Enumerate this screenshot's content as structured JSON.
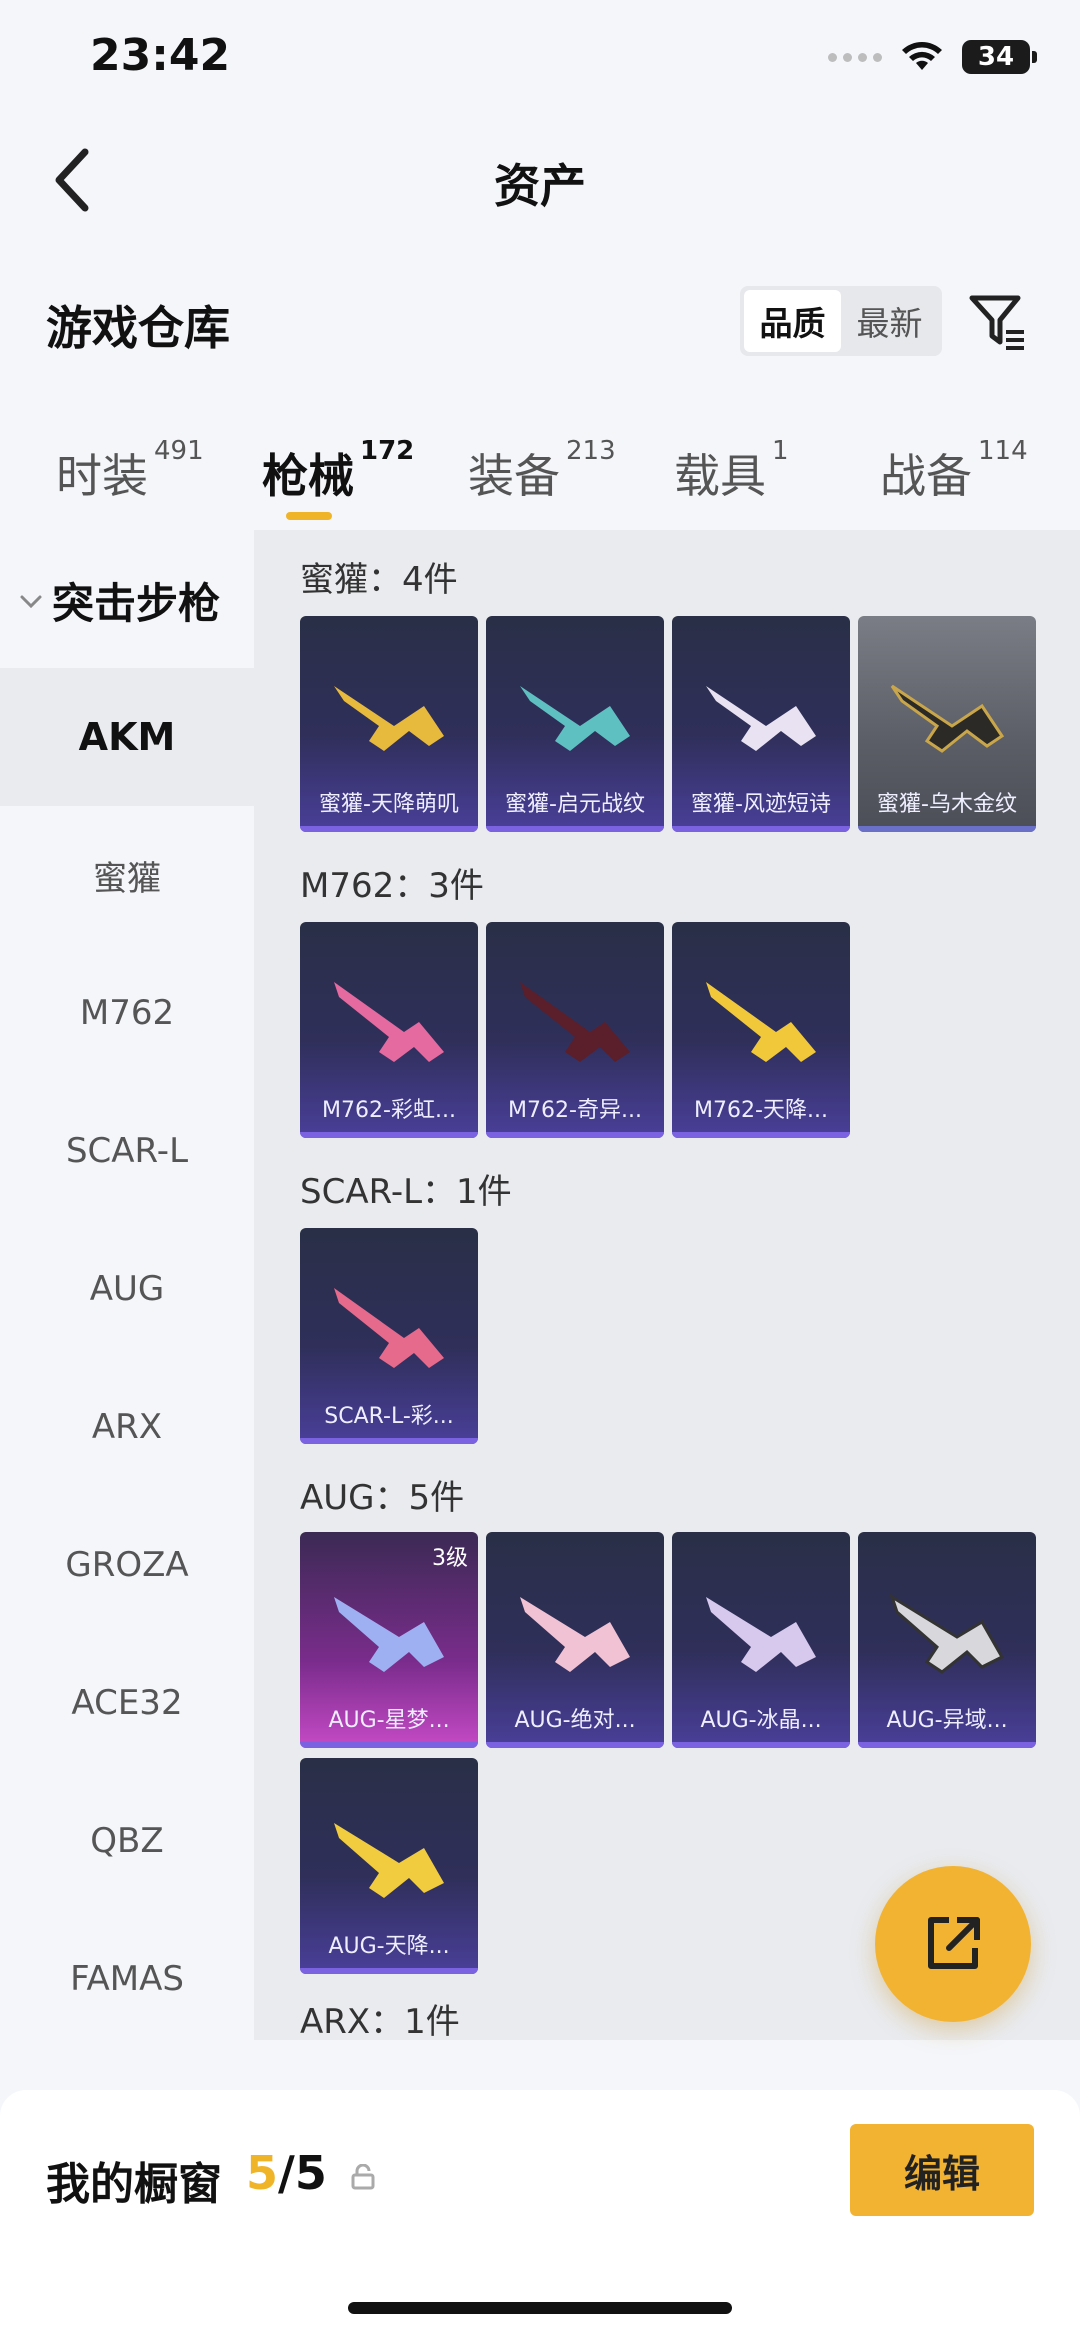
{
  "status_bar": {
    "time": "23:42",
    "battery": "34"
  },
  "header": {
    "title": "资产"
  },
  "section": {
    "title": "游戏仓库",
    "sort_options": [
      "品质",
      "最新"
    ],
    "active_sort": "品质"
  },
  "tabs": [
    {
      "label": "时装",
      "count": "491"
    },
    {
      "label": "枪械",
      "count": "172"
    },
    {
      "label": "装备",
      "count": "213"
    },
    {
      "label": "载具",
      "count": "1"
    },
    {
      "label": "战备",
      "count": "114"
    }
  ],
  "active_tab": "枪械",
  "sidebar": {
    "category": "突击步枪",
    "items": [
      "AKM",
      "蜜獾",
      "M762",
      "SCAR-L",
      "AUG",
      "ARX",
      "GROZA",
      "ACE32",
      "QBZ",
      "FAMAS"
    ],
    "active": "AKM"
  },
  "groups": [
    {
      "label": "蜜獾：4件",
      "cards": [
        "蜜獾-天降萌叽",
        "蜜獾-启元战纹",
        "蜜獾-风迹短诗",
        "蜜獾-乌木金纹"
      ]
    },
    {
      "label": "M762：3件",
      "cards": [
        "M762-彩虹...",
        "M762-奇异...",
        "M762-天降..."
      ]
    },
    {
      "label": "SCAR-L：1件",
      "cards": [
        "SCAR-L-彩..."
      ]
    },
    {
      "label": "AUG：5件",
      "cards": [
        "AUG-星梦...",
        "AUG-绝对...",
        "AUG-冰晶...",
        "AUG-异域...",
        "AUG-天降..."
      ],
      "badge": "3级"
    },
    {
      "label": "ARX：1件",
      "cards": []
    }
  ],
  "colors": {
    "accent": "#f2b332",
    "card_purple": "#4a3f9a",
    "card_grey": "#5b5d66",
    "card_pink": "#c64ac6"
  },
  "bottom_bar": {
    "title": "我的橱窗",
    "used": "5",
    "total": "/5",
    "edit_label": "编辑"
  }
}
